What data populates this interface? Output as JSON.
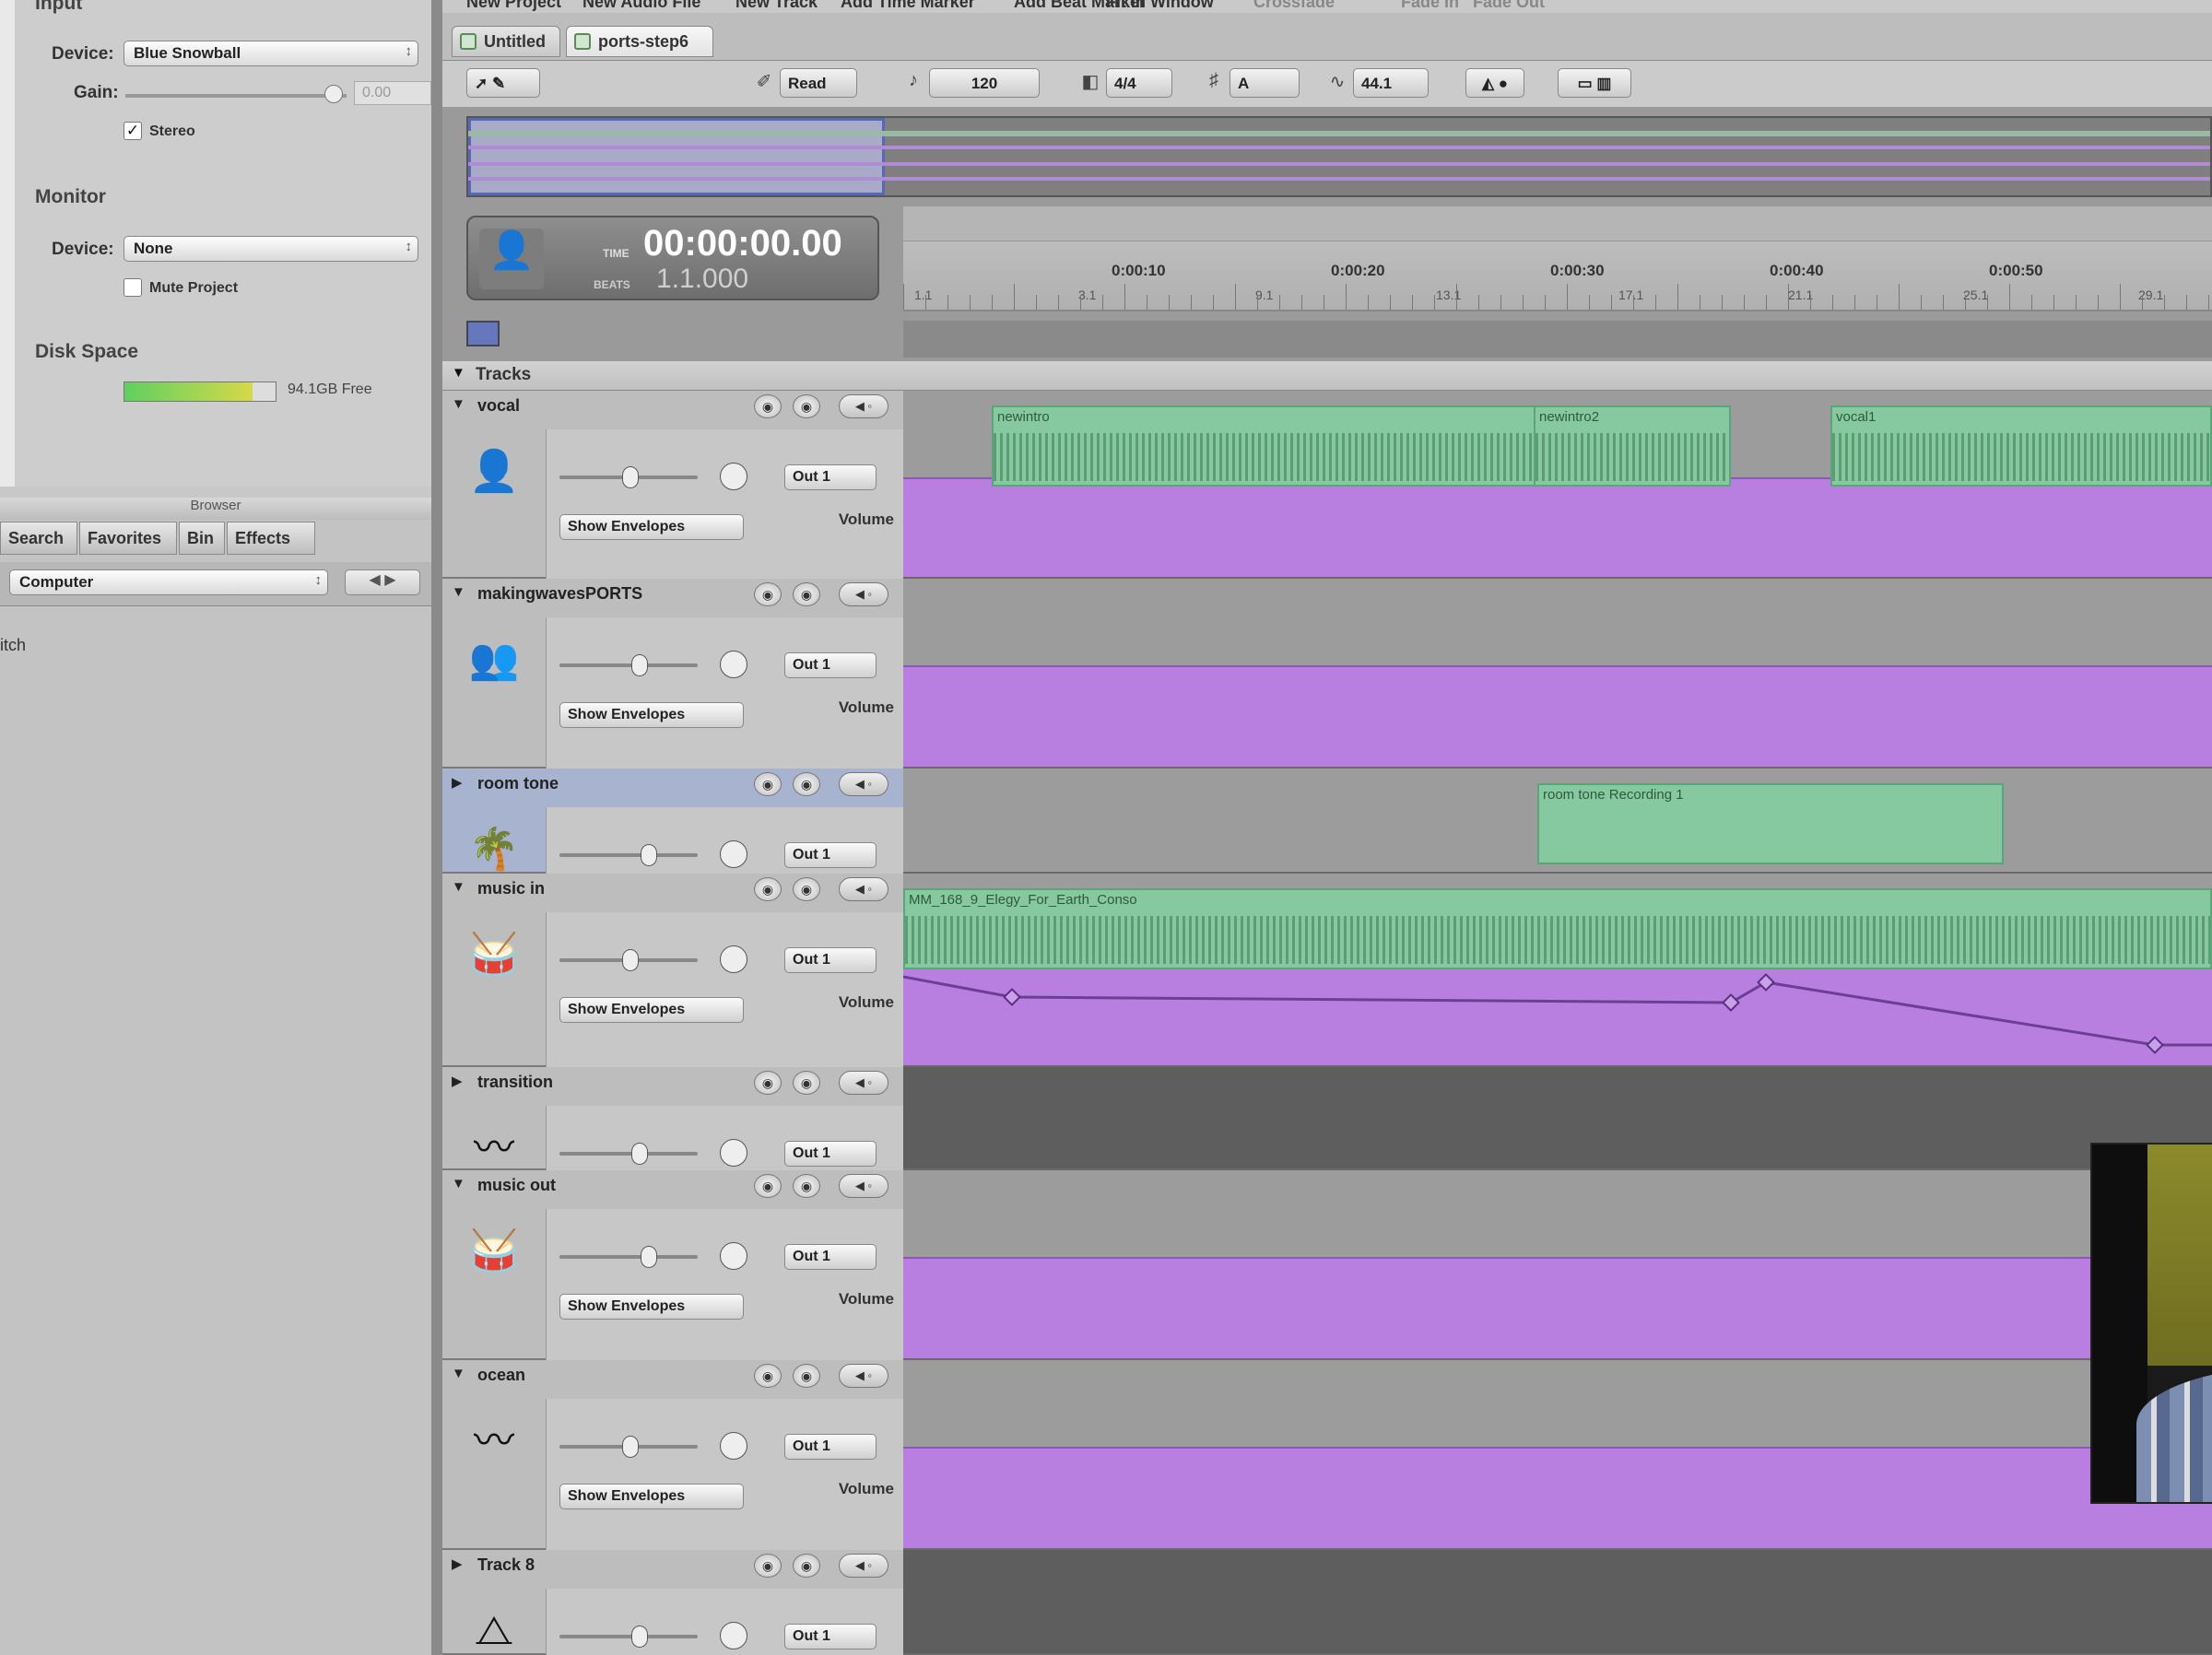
{
  "inspector": {
    "input_title": "Input",
    "device_label": "Device:",
    "device_value": "Blue Snowball",
    "gain_label": "Gain:",
    "gain_value": "0.00",
    "stereo_label": "Stereo",
    "stereo_checked": true,
    "monitor_title": "Monitor",
    "monitor_device_label": "Device:",
    "monitor_device_value": "None",
    "mute_label": "Mute Project",
    "disk_title": "Disk Space",
    "disk_free": "94.1GB Free",
    "disk_fill": 0.85
  },
  "browser": {
    "title": "Browser",
    "tabs": [
      "Search",
      "Favorites",
      "Bin",
      "Effects"
    ],
    "location": "Computer",
    "partial_item": "itch"
  },
  "menubar": [
    "New Project",
    "New Audio File",
    "New Track",
    "Add Time Marker",
    "Add Beat Marker",
    "Fit in Window",
    "Crossfade",
    "Fade In",
    "Fade Out"
  ],
  "project_tabs": [
    "Untitled",
    "ports-step6"
  ],
  "toolbar": {
    "automation_mode": "Read",
    "tempo": "120",
    "time_signature": "4/4",
    "key": "A",
    "sample_rate": "44.1"
  },
  "time_display": {
    "time_label": "TIME",
    "time_value": "00:00:00.00",
    "beats_label": "BEATS",
    "beats_value": "1.1.000"
  },
  "ruler": {
    "time_ticks": [
      "0:00:10",
      "0:00:20",
      "0:00:30",
      "0:00:40",
      "0:00:50"
    ],
    "beat_ticks": [
      "1.1",
      "3.1",
      "9.1",
      "13.1",
      "17.1",
      "21.1",
      "25.1",
      "29.1"
    ]
  },
  "tracks_header": "Tracks",
  "volume_label": "Volume",
  "show_envelopes_label": "Show Envelopes",
  "tracks": [
    {
      "name": "vocal",
      "icon": "person-icon",
      "output": "Out 1",
      "expanded": true,
      "clips": [
        "newintro",
        "newintro2",
        "vocal1"
      ]
    },
    {
      "name": "makingwavesPORTS",
      "icon": "crowd-icon",
      "output": "Out 1",
      "expanded": true,
      "clips": []
    },
    {
      "name": "room tone",
      "icon": "plant-icon",
      "output": "Out 1",
      "expanded": false,
      "clips": [
        "room tone Recording 1"
      ]
    },
    {
      "name": "music in",
      "icon": "drums-icon",
      "output": "Out 1",
      "expanded": true,
      "clips": [
        "MM_168_9_Elegy_For_Earth_Conso"
      ]
    },
    {
      "name": "transition",
      "icon": "waveform-icon",
      "output": "Out 1",
      "expanded": false,
      "clips": []
    },
    {
      "name": "music out",
      "icon": "drums-icon",
      "output": "Out 1",
      "expanded": true,
      "clips": []
    },
    {
      "name": "ocean",
      "icon": "waveform-icon",
      "output": "Out 1",
      "expanded": true,
      "clips": []
    },
    {
      "name": "Track 8",
      "icon": "metronome-icon",
      "output": "Out 1",
      "expanded": false,
      "clips": []
    }
  ],
  "colors": {
    "clip": "#86c9a0",
    "envelope": "#b87fe0",
    "selection": "#5668b8"
  }
}
